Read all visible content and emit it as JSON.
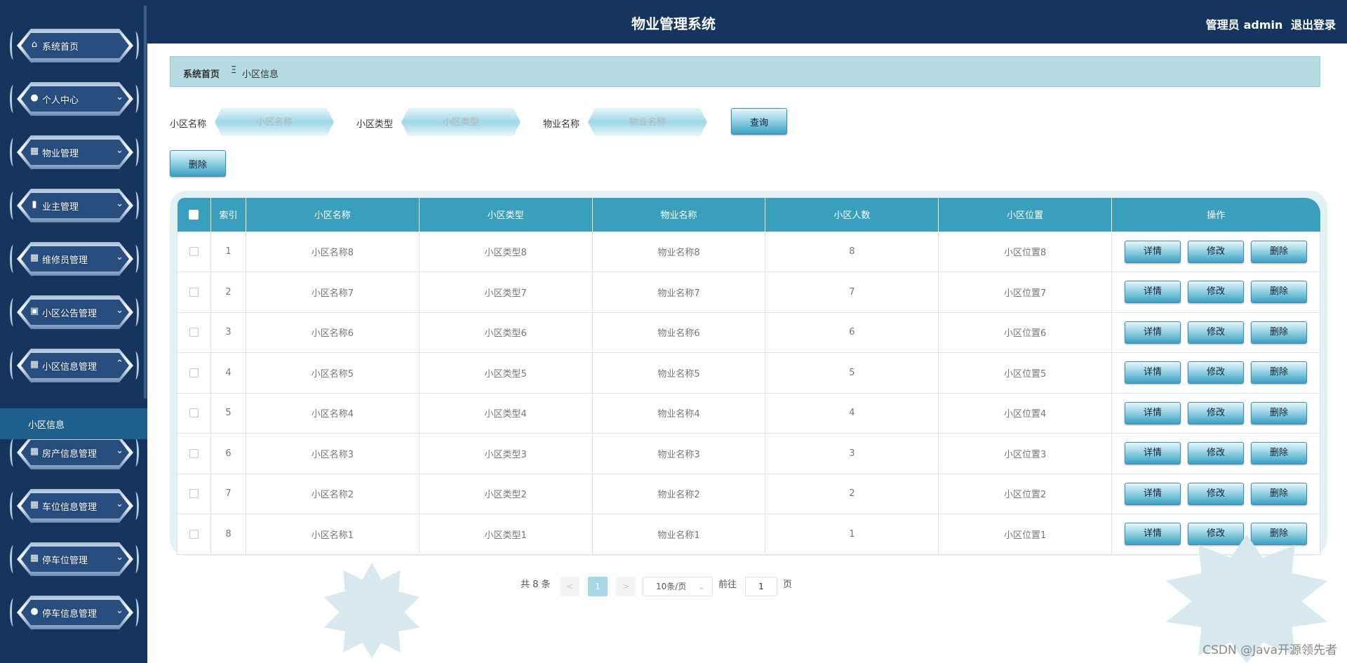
{
  "app": {
    "title": "物业管理系统",
    "role_label": "管理员",
    "username": "admin",
    "logout_label": "退出登录"
  },
  "sidebar": {
    "items": [
      {
        "label": "系统首页",
        "icon": "home-icon",
        "arrow": ""
      },
      {
        "label": "个人中心",
        "icon": "user-icon",
        "arrow": "⌄"
      },
      {
        "label": "物业管理",
        "icon": "grid-icon",
        "arrow": "⌄"
      },
      {
        "label": "业主管理",
        "icon": "bar-chart-icon",
        "arrow": "⌄"
      },
      {
        "label": "维修员管理",
        "icon": "grid-icon",
        "arrow": "⌄"
      },
      {
        "label": "小区公告管理",
        "icon": "clipboard-icon",
        "arrow": "⌄"
      },
      {
        "label": "小区信息管理",
        "icon": "grid-icon",
        "arrow": "⌃"
      },
      {
        "label": "房产信息管理",
        "icon": "grid-icon",
        "arrow": "⌄"
      },
      {
        "label": "车位信息管理",
        "icon": "grid-icon",
        "arrow": "⌄"
      },
      {
        "label": "停车位管理",
        "icon": "grid-icon",
        "arrow": "⌄"
      },
      {
        "label": "停车信息管理",
        "icon": "user-icon",
        "arrow": "⌄"
      }
    ],
    "submenu_active": "小区信息"
  },
  "breadcrumb": {
    "home": "系统首页",
    "separator": "Ξ",
    "current": "小区信息"
  },
  "search": {
    "name_label": "小区名称",
    "name_placeholder": "小区名称",
    "type_label": "小区类型",
    "type_placeholder": "小区类型",
    "property_label": "物业名称",
    "property_placeholder": "物业名称",
    "query_button": "查询"
  },
  "toolbar": {
    "delete_button": "删除"
  },
  "table": {
    "headers": [
      "索引",
      "小区名称",
      "小区类型",
      "物业名称",
      "小区人数",
      "小区位置",
      "操作"
    ],
    "action_labels": {
      "detail": "详情",
      "edit": "修改",
      "delete": "删除"
    },
    "rows": [
      {
        "index": "1",
        "name": "小区名称8",
        "type": "小区类型8",
        "property": "物业名称8",
        "count": "8",
        "location": "小区位置8"
      },
      {
        "index": "2",
        "name": "小区名称7",
        "type": "小区类型7",
        "property": "物业名称7",
        "count": "7",
        "location": "小区位置7"
      },
      {
        "index": "3",
        "name": "小区名称6",
        "type": "小区类型6",
        "property": "物业名称6",
        "count": "6",
        "location": "小区位置6"
      },
      {
        "index": "4",
        "name": "小区名称5",
        "type": "小区类型5",
        "property": "物业名称5",
        "count": "5",
        "location": "小区位置5"
      },
      {
        "index": "5",
        "name": "小区名称4",
        "type": "小区类型4",
        "property": "物业名称4",
        "count": "4",
        "location": "小区位置4"
      },
      {
        "index": "6",
        "name": "小区名称3",
        "type": "小区类型3",
        "property": "物业名称3",
        "count": "3",
        "location": "小区位置3"
      },
      {
        "index": "7",
        "name": "小区名称2",
        "type": "小区类型2",
        "property": "物业名称2",
        "count": "2",
        "location": "小区位置2"
      },
      {
        "index": "8",
        "name": "小区名称1",
        "type": "小区类型1",
        "property": "物业名称1",
        "count": "1",
        "location": "小区位置1"
      }
    ]
  },
  "pagination": {
    "total": "共 8 条",
    "prev": "<",
    "page": "1",
    "next": ">",
    "page_size": "10条/页",
    "goto_prefix": "前往",
    "goto_value": "1",
    "goto_suffix": "页"
  },
  "watermark": "CSDN @Java开源领先者",
  "colors": {
    "header": "#16355e",
    "accent": "#3a9fbd",
    "breadcrumb_bg": "#b7dbe3"
  }
}
